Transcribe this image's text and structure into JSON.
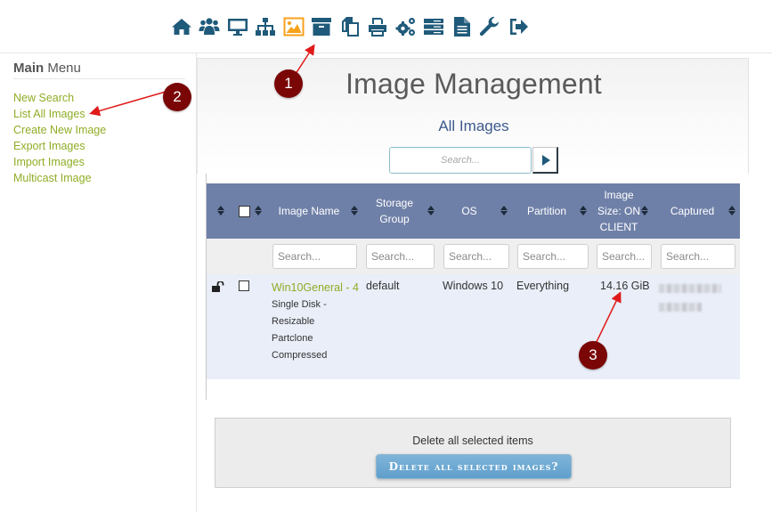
{
  "topnav": {
    "icons": [
      {
        "name": "home-icon",
        "active": false
      },
      {
        "name": "users-icon",
        "active": false
      },
      {
        "name": "monitor-icon",
        "active": false
      },
      {
        "name": "sitemap-icon",
        "active": false
      },
      {
        "name": "image-icon",
        "active": true
      },
      {
        "name": "archive-icon",
        "active": false
      },
      {
        "name": "copy-icon",
        "active": false
      },
      {
        "name": "printer-icon",
        "active": false
      },
      {
        "name": "cogs-icon",
        "active": false
      },
      {
        "name": "server-icon",
        "active": false
      },
      {
        "name": "file-icon",
        "active": false
      },
      {
        "name": "wrench-icon",
        "active": false
      },
      {
        "name": "logout-icon",
        "active": false
      }
    ],
    "active_color": "#f7a21b",
    "icon_color": "#1f5a7a"
  },
  "sidebar": {
    "title_bold": "Main",
    "title_rest": "Menu",
    "items": [
      {
        "label": "New Search"
      },
      {
        "label": "List All Images"
      },
      {
        "label": "Create New Image"
      },
      {
        "label": "Export Images"
      },
      {
        "label": "Import Images"
      },
      {
        "label": "Multicast Image"
      }
    ]
  },
  "main": {
    "title": "Image Management",
    "subtitle": "All Images",
    "search_placeholder": "Search..."
  },
  "table": {
    "columns": [
      {
        "label": ""
      },
      {
        "label": ""
      },
      {
        "label": "Image Name"
      },
      {
        "label": "Storage Group"
      },
      {
        "label": "OS"
      },
      {
        "label": "Partition"
      },
      {
        "label": "Image Size: ON CLIENT"
      },
      {
        "label": "Captured"
      }
    ],
    "filter_placeholder": "Search...",
    "rows": [
      {
        "locked": false,
        "name": "Win10General - 4",
        "description": [
          "Single Disk -",
          "Resizable",
          "Partclone",
          "Compressed"
        ],
        "storage_group": "default",
        "os": "Windows 10",
        "partition": "Everything",
        "size": "14.16 GiB",
        "captured": "[redacted]"
      }
    ]
  },
  "delete_panel": {
    "text": "Delete all selected items",
    "button_label": "Delete all selected images?"
  },
  "annotations": [
    {
      "label": "1"
    },
    {
      "label": "2"
    },
    {
      "label": "3"
    }
  ]
}
